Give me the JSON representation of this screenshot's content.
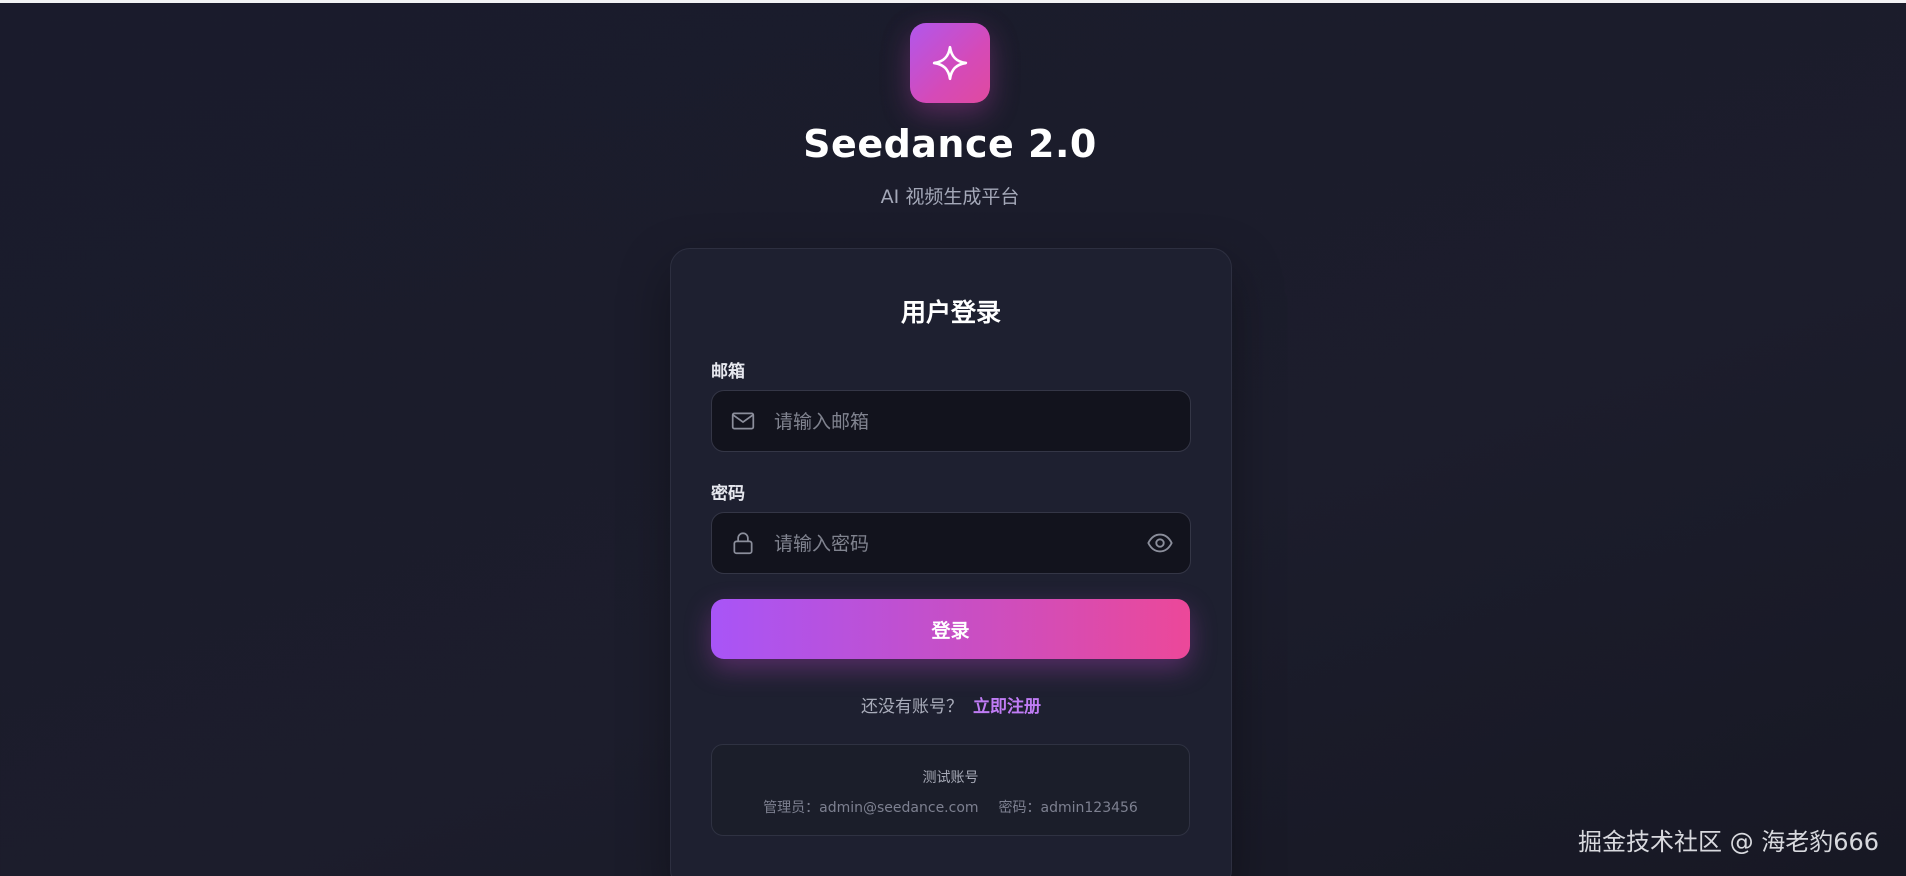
{
  "app": {
    "title": "Seedance 2.0",
    "subtitle": "AI 视频生成平台",
    "logo_icon": "sparkle-icon",
    "accent_gradient": [
      "#a855f7",
      "#ec4899"
    ]
  },
  "login_card": {
    "title": "用户登录",
    "email": {
      "label": "邮箱",
      "placeholder": "请输入邮箱",
      "value": "",
      "icon": "mail-icon"
    },
    "password": {
      "label": "密码",
      "placeholder": "请输入密码",
      "value": "",
      "icon": "lock-icon",
      "toggle_icon": "eye-icon"
    },
    "submit_label": "登录",
    "register_prompt": "还没有账号？",
    "register_link": "立即注册",
    "test_account": {
      "title": "测试账号",
      "admin": "管理员：admin@seedance.com",
      "password": "密码：admin123456"
    }
  },
  "watermark": "掘金技术社区 @ 海老豹666"
}
